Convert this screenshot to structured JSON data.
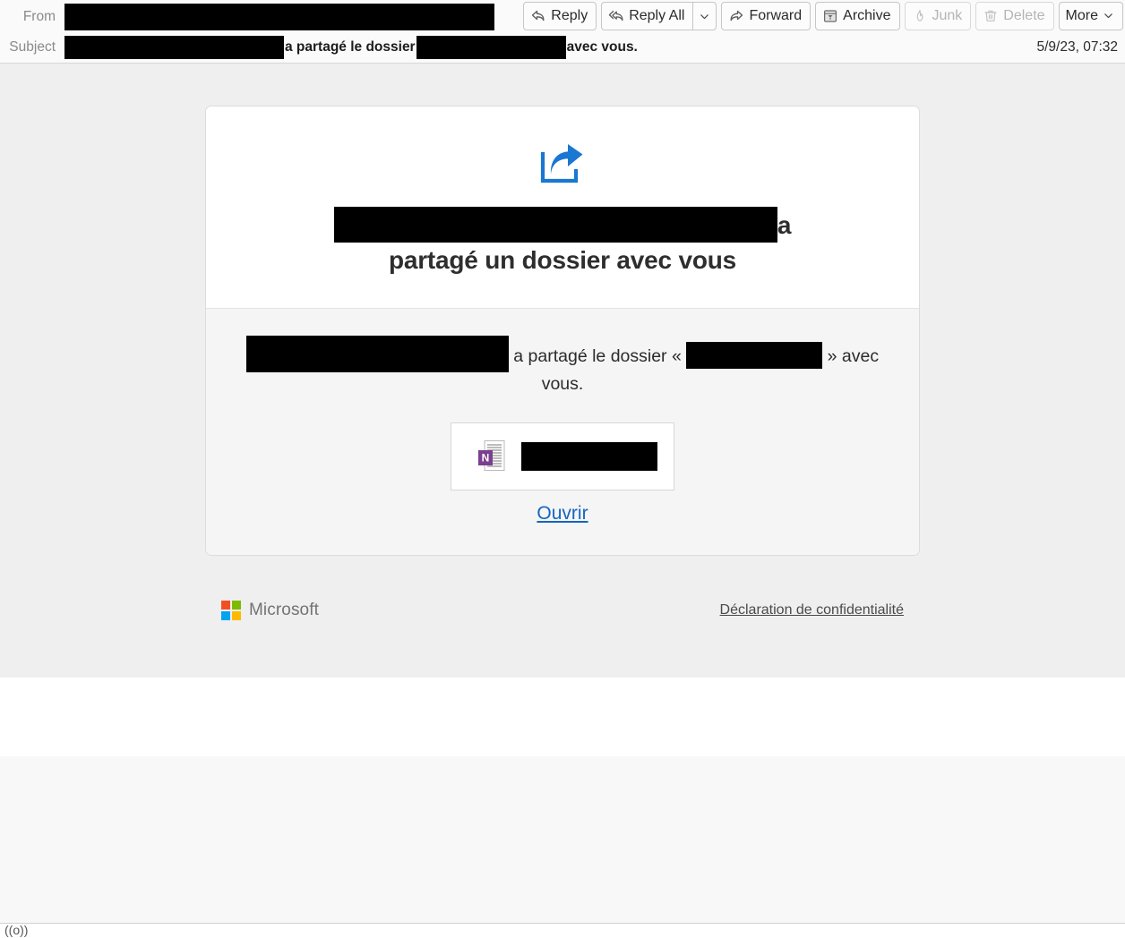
{
  "header": {
    "from_label": "From",
    "from_value_redacted": true,
    "subject_label": "Subject",
    "subject_text_1": "a partagé le dossier",
    "subject_text_2": "avec vous.",
    "date": "5/9/23, 07:32"
  },
  "toolbar": {
    "reply_label": "Reply",
    "reply_icon": "reply-arrow-icon",
    "reply_all_label": "Reply All",
    "reply_all_icon": "reply-all-arrow-icon",
    "reply_all_caret_icon": "chevron-down-icon",
    "forward_label": "Forward",
    "forward_icon": "forward-arrow-icon",
    "archive_label": "Archive",
    "archive_icon": "archive-box-icon",
    "junk_label": "Junk",
    "junk_icon": "flame-icon",
    "delete_label": "Delete",
    "delete_icon": "trash-icon",
    "more_label": "More",
    "more_caret_icon": "chevron-down-icon"
  },
  "email": {
    "share_icon": "share-arrow-icon",
    "heading_suffix": "a",
    "heading_line2": "partagé un dossier avec vous",
    "body_text_1": "a partagé le dossier «",
    "body_text_2": "» avec vous.",
    "attachment": {
      "file_icon": "onenote-file-icon",
      "filename_redacted": true
    },
    "open_link": "Ouvrir",
    "brand_name": "Microsoft",
    "privacy_link": "Déclaration de confidentialité"
  },
  "statusbar": {
    "glyph": "((o))"
  },
  "colors": {
    "share_blue": "#1a77d2",
    "link_blue": "#1565c0",
    "onenote_purple": "#7b3f8f",
    "ms_red": "#f25022",
    "ms_green": "#7fba00",
    "ms_blue": "#00a4ef",
    "ms_yellow": "#ffb900",
    "body_bg": "#efefef",
    "card_bottom_bg": "#f5f5f5"
  }
}
